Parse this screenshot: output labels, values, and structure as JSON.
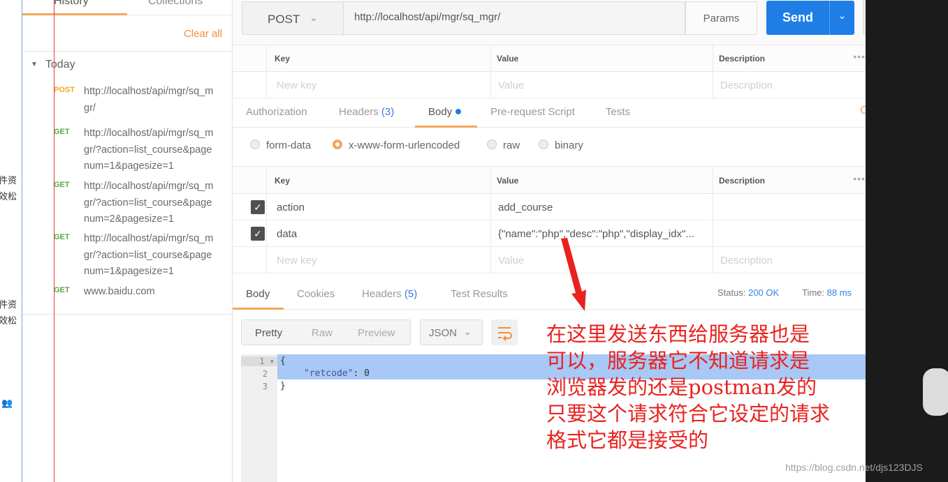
{
  "strip": {
    "lines": [
      "件资",
      "效松",
      "件资",
      "效松"
    ]
  },
  "sidebar": {
    "tab_history": "History",
    "tab_collections": "Collections",
    "clear_all": "Clear all",
    "group": "Today",
    "items": [
      {
        "method": "POST",
        "url": "http://localhost/api/mgr/sq_mgr/"
      },
      {
        "method": "GET",
        "url": "http://localhost/api/mgr/sq_mgr/?action=list_course&pagenum=1&pagesize=1"
      },
      {
        "method": "GET",
        "url": "http://localhost/api/mgr/sq_mgr/?action=list_course&pagenum=2&pagesize=1"
      },
      {
        "method": "GET",
        "url": "http://localhost/api/mgr/sq_mgr/?action=list_course&pagenum=1&pagesize=1"
      },
      {
        "method": "GET",
        "url": "www.baidu.com"
      }
    ]
  },
  "request": {
    "method": "POST",
    "url": "http://localhost/api/mgr/sq_mgr/",
    "params_label": "Params",
    "send_label": "Send"
  },
  "params_table": {
    "col_key": "Key",
    "col_value": "Value",
    "col_desc": "Description",
    "ph_key": "New key",
    "ph_value": "Value",
    "ph_desc": "Description"
  },
  "req_tabs": {
    "authorization": "Authorization",
    "headers": "Headers",
    "headers_count": "(3)",
    "body": "Body",
    "prerequest": "Pre-request Script",
    "tests": "Tests"
  },
  "body_types": {
    "form_data": "form-data",
    "urlencoded": "x-www-form-urlencoded",
    "raw": "raw",
    "binary": "binary",
    "selected": "x-www-form-urlencoded"
  },
  "body_table": {
    "col_key": "Key",
    "col_value": "Value",
    "col_desc": "Description",
    "rows": [
      {
        "key": "action",
        "value": "add_course",
        "checked": true
      },
      {
        "key": "data",
        "value": "{\"name\":\"php\",\"desc\":\"php\",\"display_idx\"...",
        "checked": true
      }
    ],
    "ph_key": "New key",
    "ph_value": "Value",
    "ph_desc": "Description"
  },
  "response": {
    "tab_body": "Body",
    "tab_cookies": "Cookies",
    "tab_headers": "Headers",
    "headers_count": "(5)",
    "tab_tests": "Test Results",
    "status_label": "Status:",
    "status_value": "200 OK",
    "time_label": "Time:",
    "time_value": "88 ms",
    "fmt_pretty": "Pretty",
    "fmt_raw": "Raw",
    "fmt_preview": "Preview",
    "lang": "JSON",
    "line_numbers": [
      "1",
      "2",
      "3"
    ],
    "code": {
      "open": "{",
      "key": "\"retcode\"",
      "sep": ": ",
      "val": "0",
      "close": "}"
    }
  },
  "annotation": {
    "lines": [
      "在这里发送东西给服务器也是",
      "可以，服务器它不知道请求是",
      "浏览器发的还是postman发的",
      "只要这个请求符合它设定的请求",
      "格式它都是接受的"
    ],
    "color": "#e8231f"
  },
  "watermark": "https://blog.csdn.net/djs123DJS",
  "colors": {
    "accent_orange": "#f4a65c",
    "send_blue": "#1e7ee6",
    "get_green": "#59a847",
    "post_orange": "#f5a623"
  }
}
